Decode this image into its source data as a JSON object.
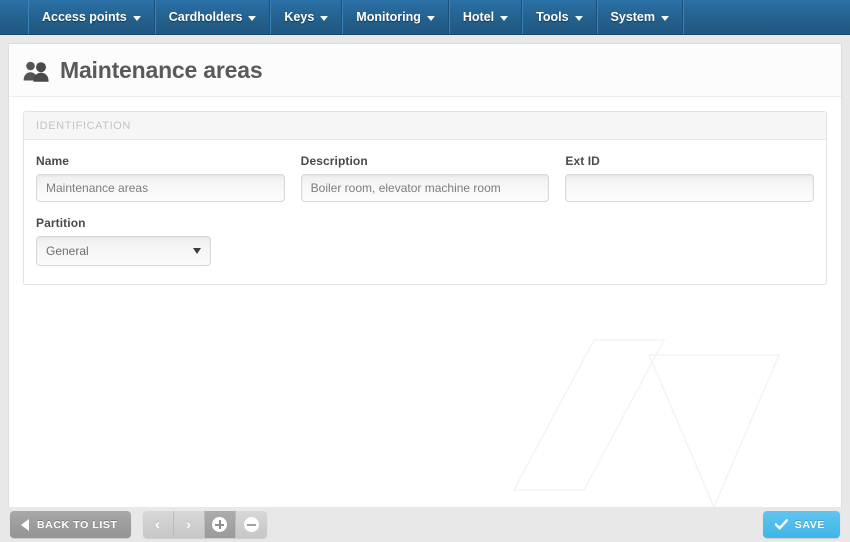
{
  "navbar": {
    "items": [
      {
        "label": "Access points",
        "caret": "chevron-down-icon"
      },
      {
        "label": "Cardholders",
        "caret": "chevron-down-icon"
      },
      {
        "label": "Keys",
        "caret": "chevron-down-icon"
      },
      {
        "label": "Monitoring",
        "caret": "chevron-down-icon"
      },
      {
        "label": "Hotel",
        "caret": "chevron-down-icon"
      },
      {
        "label": "Tools",
        "caret": "chevron-down-icon"
      },
      {
        "label": "System",
        "caret": "chevron-down-icon"
      }
    ],
    "background_color": "#25628f"
  },
  "header": {
    "title": "Maintenance areas",
    "icon": "users-group-icon",
    "icon_color": "#5a5a5a"
  },
  "panel": {
    "legend": "IDENTIFICATION",
    "fields": {
      "name": {
        "label": "Name",
        "value": "Maintenance areas",
        "placeholder": ""
      },
      "description": {
        "label": "Description",
        "value": "Boiler room, elevator machine room",
        "placeholder": ""
      },
      "ext_id": {
        "label": "Ext ID",
        "value": "",
        "placeholder": ""
      },
      "partition": {
        "label": "Partition",
        "value": "General",
        "options": [
          "General"
        ],
        "caret": "chevron-down-icon"
      }
    }
  },
  "toolbar": {
    "back_label": "BACK TO LIST",
    "back_icon": "arrow-left-icon",
    "save_label": "SAVE",
    "save_icon": "check-icon",
    "save_color": "#4fbdec",
    "nav_buttons": [
      {
        "name": "previous-record-button",
        "glyph": "‹",
        "active": false
      },
      {
        "name": "next-record-button",
        "glyph": "›",
        "active": false
      },
      {
        "name": "add-record-button",
        "glyph": "+",
        "active": true
      },
      {
        "name": "delete-record-button",
        "glyph": "−",
        "active": false
      }
    ]
  }
}
